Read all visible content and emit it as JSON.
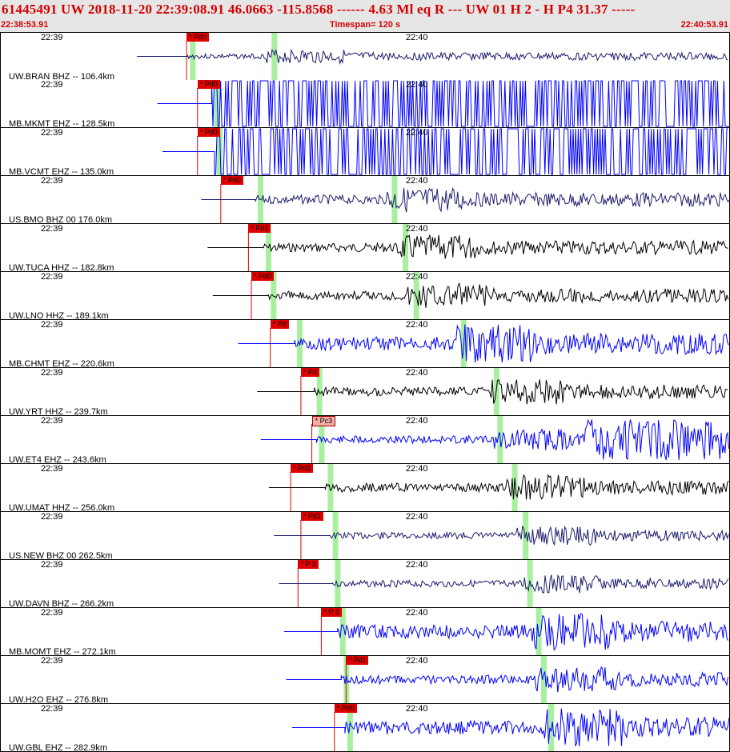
{
  "header": {
    "title": "61445491 UW 2018-11-20 22:39:08.91   46.0663 -115.8568 ------  4.63 Ml  eq  R ---     UW 01  H   2  -  H P4   31.37 -----",
    "start_time": "22:38:53.91",
    "timespan": "Timespan= 120 s",
    "end_time": "22:40:53.91"
  },
  "time_labels": [
    "22:39",
    "22:40"
  ],
  "colors": {
    "header_text": "#d40000",
    "pick": "#e00000",
    "pick_line": "#e00000",
    "phase_band": "#a8f0a0",
    "blue": "#0000ff",
    "navy": "#1c1c6c",
    "black": "#000000"
  },
  "traces": [
    {
      "label": "UW.BRAN BHZ -- 106.4km",
      "pick": "* Pd0",
      "color": "navy",
      "pick_frac": 0.255,
      "band1": 0.263,
      "band2": 0.375,
      "start_frac": 0.187,
      "amp": "low",
      "clip": false
    },
    {
      "label": "MB.MKMT EHZ -- 128.5km",
      "pick": "* Pd0",
      "color": "blue",
      "pick_frac": 0.27,
      "band1": 0.296,
      "band2": null,
      "start_frac": 0.215,
      "amp": "clip",
      "clip": true
    },
    {
      "label": "MB.VCMT EHZ -- 135.0km",
      "pick": "* Pd0",
      "color": "blue",
      "pick_frac": 0.27,
      "band1": 0.3,
      "band2": null,
      "start_frac": 0.222,
      "amp": "clip",
      "clip": true
    },
    {
      "label": "US.BMO BHZ 00 176.0km",
      "pick": "* Pd0",
      "color": "navy",
      "pick_frac": 0.302,
      "band1": 0.356,
      "band2": 0.54,
      "start_frac": 0.275,
      "amp": "mid",
      "clip": false
    },
    {
      "label": "UW.TUCA HHZ -- 182.8km",
      "pick": "* Pd1",
      "color": "black",
      "pick_frac": 0.34,
      "band1": 0.367,
      "band2": 0.555,
      "start_frac": 0.284,
      "amp": "mid",
      "clip": false
    },
    {
      "label": "UW.LNO HHZ -- 189.1km",
      "pick": "* Pd0",
      "color": "black",
      "pick_frac": 0.344,
      "band1": 0.374,
      "band2": 0.57,
      "start_frac": 0.291,
      "amp": "mid",
      "clip": false
    },
    {
      "label": "MB.CHMT EHZ -- 220.6km",
      "pick": "* Pd",
      "color": "blue",
      "pick_frac": 0.37,
      "band1": 0.41,
      "band2": 0.635,
      "start_frac": 0.326,
      "amp": "high",
      "clip": false
    },
    {
      "label": "UW.YRT HHZ -- 239.7km",
      "pick": "* Pd",
      "color": "black",
      "pick_frac": 0.412,
      "band1": 0.437,
      "band2": 0.68,
      "start_frac": 0.352,
      "amp": "mid",
      "clip": false
    },
    {
      "label": "UW.ET4 EHZ -- 243.6km",
      "pick": "* Pc3",
      "color": "blue",
      "pick_frac": 0.427,
      "band1": 0.44,
      "band2": 0.685,
      "start_frac": 0.357,
      "amp": "spike",
      "clip": false,
      "selected": true
    },
    {
      "label": "UW.UMAT HHZ -- 256.0km",
      "pick": "* Pd3",
      "color": "black",
      "pick_frac": 0.398,
      "band1": 0.452,
      "band2": 0.705,
      "start_frac": 0.368,
      "amp": "mid",
      "clip": false
    },
    {
      "label": "US.NEW BHZ 00 262.5km",
      "pick": "* Pd1",
      "color": "navy",
      "pick_frac": 0.412,
      "band1": 0.459,
      "band2": 0.72,
      "start_frac": 0.375,
      "amp": "lowmid",
      "clip": false
    },
    {
      "label": "UW.DAVN BHZ -- 266.2km",
      "pick": "* P 3",
      "color": "navy",
      "pick_frac": 0.408,
      "band1": 0.462,
      "band2": 0.726,
      "start_frac": 0.382,
      "amp": "lowmid",
      "clip": false
    },
    {
      "label": "MB.MOMT EHZ -- 272.1km",
      "pick": "* P 2",
      "color": "blue",
      "pick_frac": 0.44,
      "band1": 0.469,
      "band2": 0.738,
      "start_frac": 0.389,
      "amp": "high",
      "clip": false
    },
    {
      "label": "UW.H2O EHZ -- 276.8km",
      "pick": "* Pd1",
      "color": "blue",
      "pick_frac": 0.474,
      "band1": 0.474,
      "band2": 0.745,
      "start_frac": 0.392,
      "amp": "mid",
      "clip": false
    },
    {
      "label": "UW.GBL EHZ -- 282.9km",
      "pick": "* Pd0",
      "color": "blue",
      "pick_frac": 0.458,
      "band1": 0.479,
      "band2": 0.755,
      "start_frac": 0.4,
      "amp": "high",
      "clip": false
    }
  ]
}
